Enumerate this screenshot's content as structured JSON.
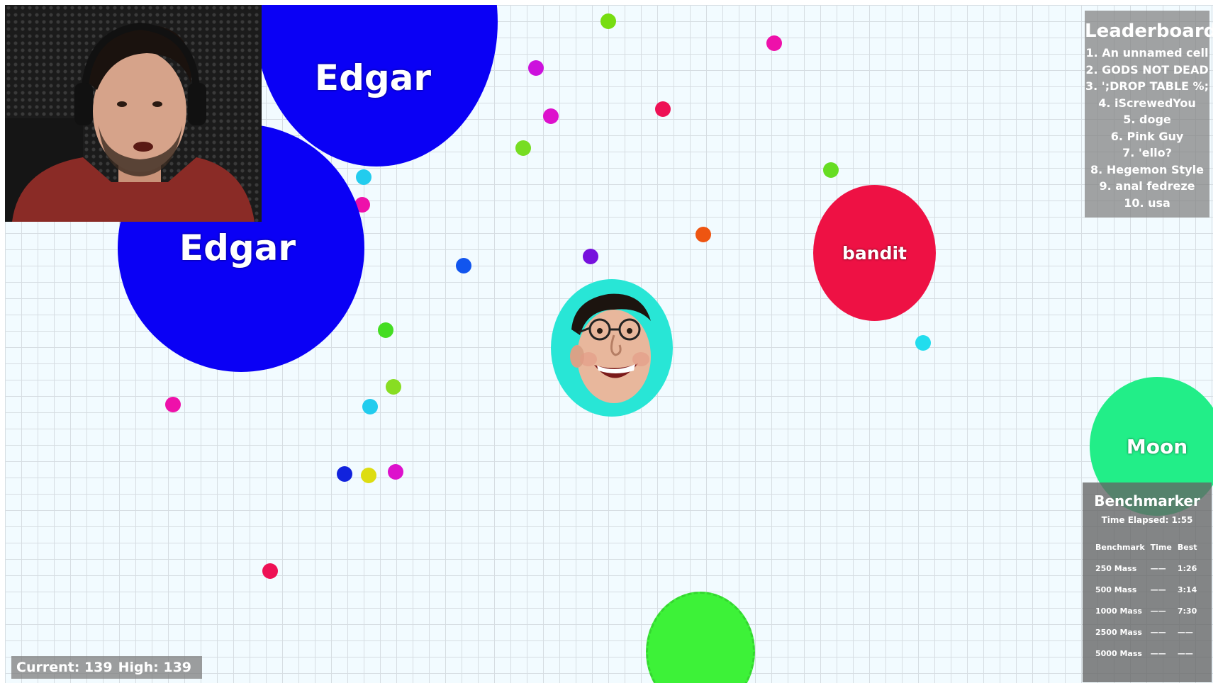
{
  "cells": {
    "edgar_1": {
      "name": "Edgar",
      "color": "#0a00f5"
    },
    "edgar_2": {
      "name": "Edgar",
      "color": "#0a00f5"
    },
    "bandit": {
      "name": "bandit",
      "color": "#ee1144"
    },
    "moon": {
      "name": "Moon",
      "color": "#22ee88"
    },
    "player": {
      "name": "",
      "color": "#28e6d6"
    },
    "green_blob": {
      "name": "",
      "color": "#3df238"
    }
  },
  "leaderboard": {
    "title": "Leaderboard",
    "entries": [
      "1. An unnamed cell",
      "2. GODS NOT DEAD",
      "3. ';DROP TABLE %;",
      "4. iScrewedYou",
      "5. doge",
      "6. Pink Guy",
      "7. 'ello?",
      "8. Hegemon Style",
      "9. anal fedreze",
      "10. usa"
    ]
  },
  "benchmarker": {
    "title": "Benchmarker",
    "elapsed": "Time Elapsed: 1:55",
    "headers": [
      "Benchmark",
      "Time",
      "Best"
    ],
    "rows": [
      [
        "250 Mass",
        "——",
        "1:26"
      ],
      [
        "500 Mass",
        "——",
        "3:14"
      ],
      [
        "1000 Mass",
        "——",
        "7:30"
      ],
      [
        "2500 Mass",
        "——",
        "——"
      ],
      [
        "5000 Mass",
        "——",
        "——"
      ]
    ]
  },
  "score": {
    "current": "Current: 139",
    "high": "High: 139"
  },
  "webcam": {
    "icon": "streamer-webcam-feed"
  }
}
